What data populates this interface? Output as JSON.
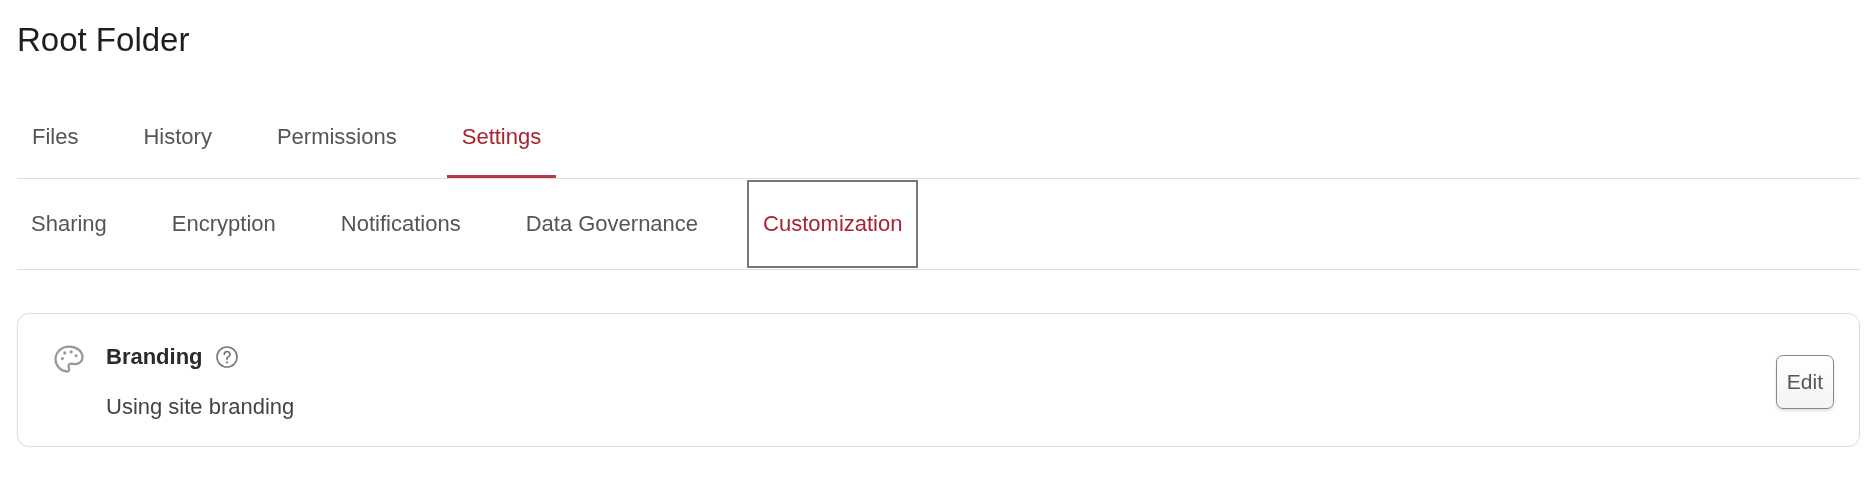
{
  "page": {
    "title": "Root Folder"
  },
  "tabs": [
    {
      "label": "Files",
      "selected": false
    },
    {
      "label": "History",
      "selected": false
    },
    {
      "label": "Permissions",
      "selected": false
    },
    {
      "label": "Settings",
      "selected": true
    }
  ],
  "subtabs": [
    {
      "label": "Sharing",
      "selected": false
    },
    {
      "label": "Encryption",
      "selected": false
    },
    {
      "label": "Notifications",
      "selected": false
    },
    {
      "label": "Data Governance",
      "selected": false
    },
    {
      "label": "Customization",
      "selected": true
    }
  ],
  "card": {
    "title": "Branding",
    "description": "Using site branding",
    "button": "Edit"
  }
}
